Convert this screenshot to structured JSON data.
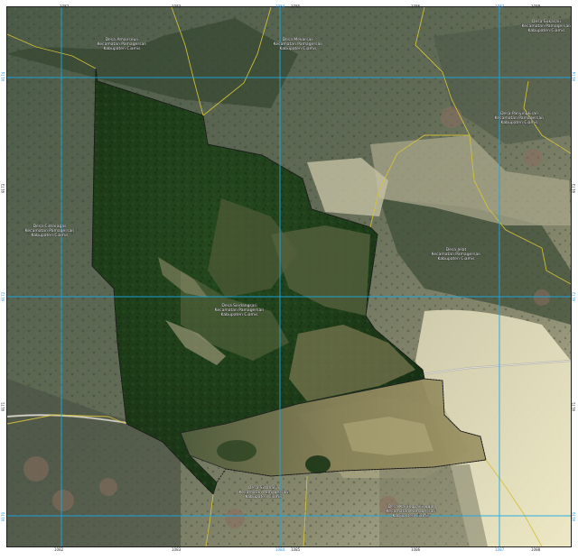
{
  "map": {
    "colors": {
      "grid": "#19a9e6",
      "boundary": "#d6c13a",
      "study_area_outline": "#222222",
      "study_area_forest": "#1d3b18",
      "study_area_field": "#6d6a44",
      "frame": "#202020"
    },
    "area_labels": [
      {
        "line1": "Desa Amanseuri",
        "line2": "Kecamatan Pamagersari",
        "line3": "Kabupaten Ciamis"
      },
      {
        "line1": "Desa Mekarsari",
        "line2": "Kecamatan Pamagersari",
        "line3": "Kabupaten Ciamis"
      },
      {
        "line1": "Desa Sukasari",
        "line2": "Kecamatan Pamagersari",
        "line3": "Kabupaten Ciamis"
      },
      {
        "line1": "Desa Panyingkiran",
        "line2": "Kecamatan Pamagersari",
        "line3": "Kabupaten Ciamis"
      },
      {
        "line1": "Desa Cimaragas",
        "line2": "Kecamatan Pamagersari",
        "line3": "Kabupaten Ciamis"
      },
      {
        "line1": "Desa Jelat",
        "line2": "Kecamatan Pamagersari",
        "line3": "Kabupaten Ciamis"
      },
      {
        "line1": "Desa Sindangsari",
        "line2": "Kecamatan Pamagersari",
        "line3": "Kabupaten Ciamis"
      },
      {
        "line1": "Desa Sidaharja",
        "line2": "Kecamatan Pamagersari",
        "line3": "Kabupaten Ciamis"
      },
      {
        "line1": "Desa Karangpaninggal",
        "line2": "Kecamatan Pamagersari",
        "line3": "Kabupaten Ciamis"
      },
      {
        "line1": "Desa Cijulang",
        "line2": "Kecamatan Pamagersari",
        "line3": "Kabupaten Ciamis"
      }
    ],
    "coord_top": [
      "1082",
      "1083",
      "1084",
      "1085",
      "1086",
      "1087",
      "1088",
      "1089",
      "1090",
      "1091"
    ],
    "coord_left": [
      "9174",
      "9173",
      "9172",
      "9171",
      "9170",
      "9169",
      "9168"
    ]
  }
}
